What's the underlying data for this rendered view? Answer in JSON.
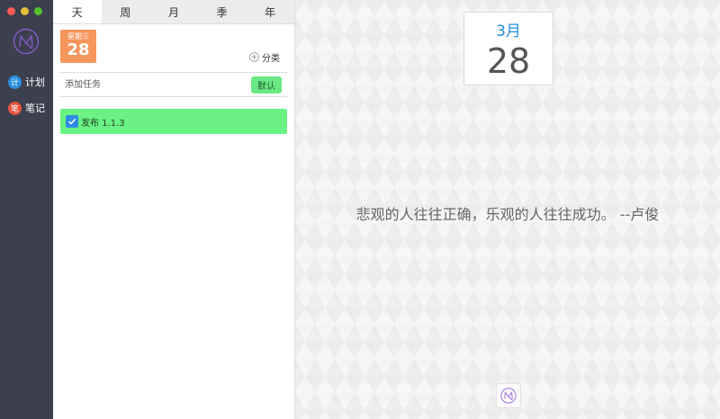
{
  "sidebar": {
    "nav": [
      {
        "badge": "计",
        "label": "计划",
        "color": "#2b8fdf"
      },
      {
        "badge": "笔",
        "label": "笔记",
        "color": "#e8523b"
      }
    ]
  },
  "tabs": [
    "天",
    "周",
    "月",
    "季",
    "年"
  ],
  "active_tab": "天",
  "date_card": {
    "weekday": "星期三",
    "day": "28"
  },
  "category_label": "分类",
  "add_task": {
    "placeholder": "添加任务",
    "default_label": "默认"
  },
  "tasks": [
    {
      "label": "发布 1.1.3",
      "checked": true
    }
  ],
  "calendar": {
    "month": "3月",
    "day": "28"
  },
  "quote": "悲观的人往往正确，乐观的人往往成功。 --卢俊"
}
